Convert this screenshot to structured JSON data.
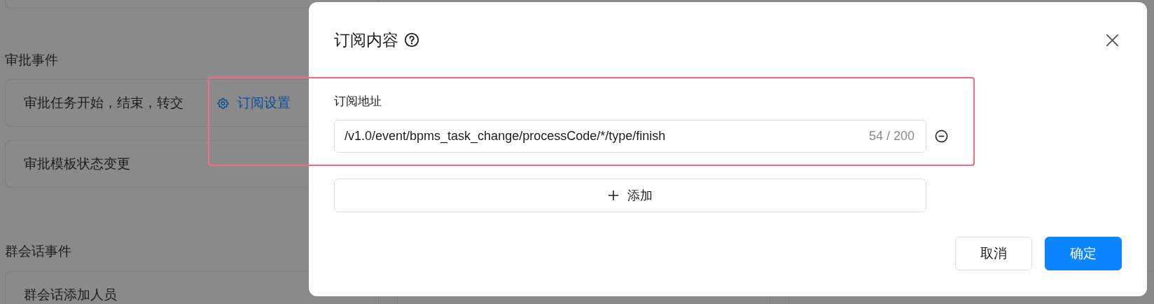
{
  "background": {
    "sections": [
      {
        "heading": "审批事件",
        "items": [
          {
            "label": "审批任务开始，结束，转交",
            "link": "订阅设置"
          },
          {
            "label": "审批模板状态变更"
          }
        ]
      },
      {
        "heading": "群会话事件",
        "items": [
          {
            "label": "群会话添加人员"
          }
        ]
      }
    ]
  },
  "dialog": {
    "title": "订阅内容",
    "field_label": "订阅地址",
    "urls": [
      {
        "value": "/v1.0/event/bpms_task_change/processCode/*/type/finish",
        "count": "54 / 200"
      }
    ],
    "add_button": "添加",
    "buttons": [
      {
        "label": "取消",
        "kind": "default"
      },
      {
        "label": "确定",
        "kind": "primary"
      }
    ]
  }
}
